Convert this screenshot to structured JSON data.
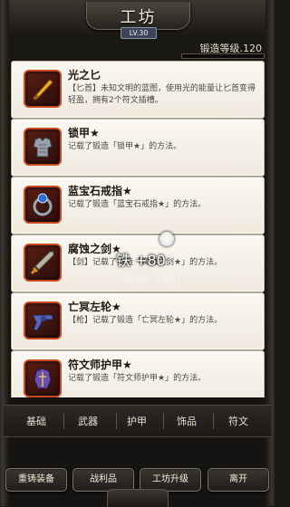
{
  "header": {
    "title": "工坊",
    "level": "LV.30",
    "forge_level_label": "锻造等级.120",
    "forge_progress": 0.0
  },
  "items": [
    {
      "name": "光之匕",
      "desc": "【匕首】未知文明的蓝图，使用光的能量让匕首变得轻盈，拥有2个符文插槽。",
      "icon": "dagger-icon"
    },
    {
      "name": "锁甲★",
      "desc": "记载了锻造「锁甲★」的方法。",
      "icon": "chainmail-icon"
    },
    {
      "name": "蓝宝石戒指★",
      "desc": "记载了锻造「蓝宝石戒指★」的方法。",
      "icon": "sapphire-ring-icon"
    },
    {
      "name": "腐蚀之剑★",
      "desc": "【剑】记载了锻造「腐蚀之剑★」的方法。",
      "icon": "sword-icon"
    },
    {
      "name": "亡冥左轮★",
      "desc": "【枪】记载了锻造「亡冥左轮★」的方法。",
      "icon": "revolver-icon"
    },
    {
      "name": "符文师护甲★",
      "desc": "记载了锻造「符文师护甲★」的方法。",
      "icon": "runemaster-armor-icon"
    }
  ],
  "floating": {
    "gain": "铁 +80",
    "ghost": "木材 +60"
  },
  "categories": [
    "基础",
    "武器",
    "护甲",
    "饰品",
    "符文"
  ],
  "bottom_buttons": [
    "重铸装备",
    "战利品",
    "工坊升级",
    "离开"
  ]
}
